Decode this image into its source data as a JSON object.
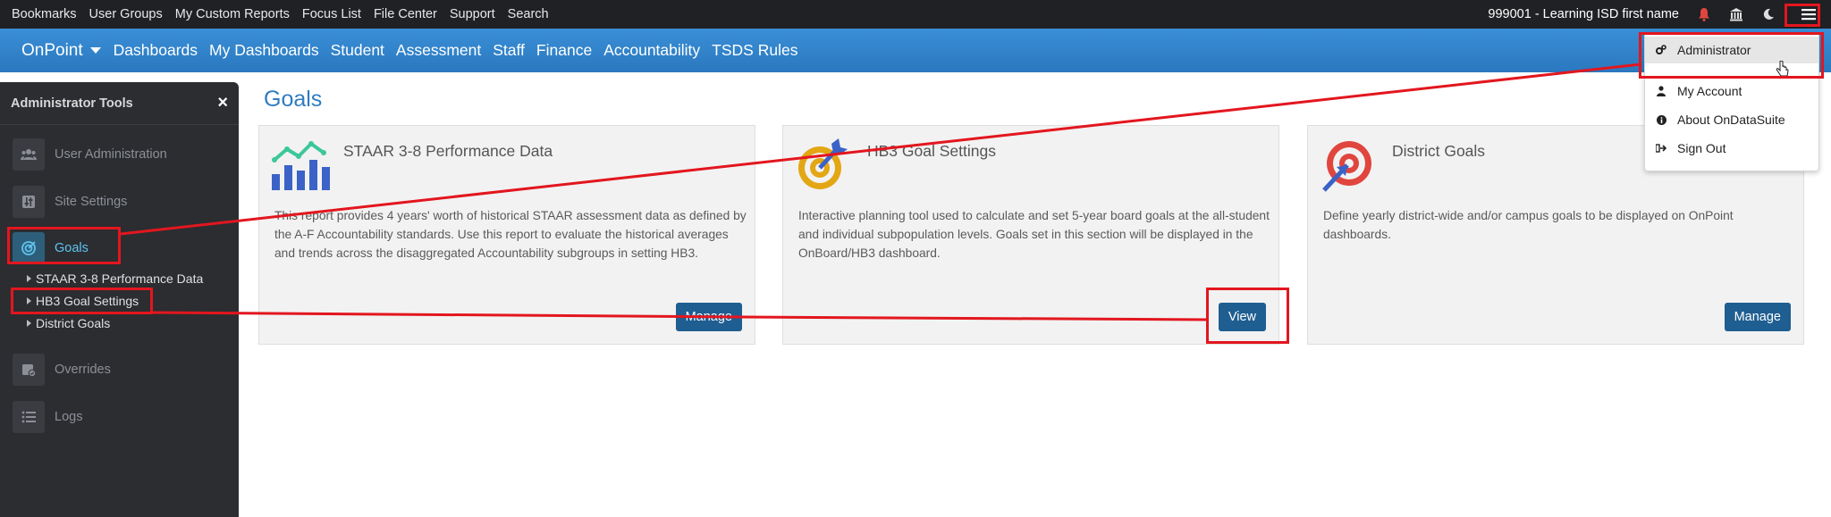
{
  "topbar": {
    "links": [
      "Bookmarks",
      "User Groups",
      "My Custom Reports",
      "Focus List",
      "File Center",
      "Support",
      "Search"
    ],
    "district": "999001 - Learning ISD first name",
    "icons": [
      "bell-icon",
      "building-icon",
      "moon-icon",
      "hamburger-menu-icon"
    ]
  },
  "nav": {
    "brand": "OnPoint",
    "items": [
      "Dashboards",
      "My Dashboards",
      "Student",
      "Assessment",
      "Staff",
      "Finance",
      "Accountability",
      "TSDS Rules"
    ]
  },
  "sidebar": {
    "title": "Administrator Tools",
    "close": "×",
    "items": [
      {
        "label": "User Administration",
        "icon": "users-icon"
      },
      {
        "label": "Site Settings",
        "icon": "sliders-icon"
      },
      {
        "label": "Goals",
        "icon": "target-icon"
      },
      {
        "label": "Overrides",
        "icon": "calendar-check-icon"
      },
      {
        "label": "Logs",
        "icon": "list-icon"
      }
    ],
    "subitems": [
      "STAAR 3-8 Performance Data",
      "HB3 Goal Settings",
      "District Goals"
    ]
  },
  "main": {
    "title": "Goals",
    "cards": [
      {
        "title": "STAAR 3-8 Performance Data",
        "desc": "This report provides 4 years' worth of historical STAAR assessment data as defined by the A-F Accountability standards. Use this report to evaluate the historical averages and trends across the disaggregated Accountability subgroups in setting HB3.",
        "button": "Manage",
        "icon": "bar-chart-trend-icon"
      },
      {
        "title": "HB3 Goal Settings",
        "desc": "Interactive planning tool used to calculate and set 5-year board goals at the all-student and individual subpopulation levels. Goals set in this section will be displayed in the OnBoard/HB3 dashboard.",
        "button": "View",
        "icon": "target-arrow-icon"
      },
      {
        "title": "District Goals",
        "desc": "Define yearly district-wide and/or campus goals to be displayed on OnPoint dashboards.",
        "button": "Manage",
        "icon": "bullseye-icon"
      }
    ]
  },
  "menu": {
    "items": [
      {
        "label": "Administrator",
        "icon": "cogs-icon"
      },
      {
        "label": "My Account",
        "icon": "user-icon"
      },
      {
        "label": "About OnDataSuite",
        "icon": "info-icon"
      },
      {
        "label": "Sign Out",
        "icon": "sign-out-icon"
      }
    ]
  },
  "colors": {
    "topbar": "#1f2124",
    "nav": "#2a78bf",
    "sidebar": "#2b2d31",
    "accent": "#2f7cc1",
    "button": "#1f5e91",
    "annotation": "#e3161e"
  }
}
